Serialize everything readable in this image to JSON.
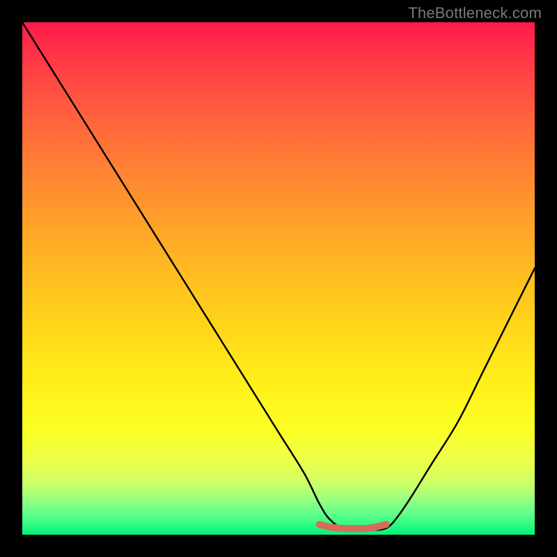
{
  "watermark_text": "TheBottleneck.com",
  "chart_data": {
    "type": "line",
    "title": "",
    "xlabel": "",
    "ylabel": "",
    "xlim": [
      0,
      100
    ],
    "ylim": [
      0,
      100
    ],
    "series": [
      {
        "name": "curve",
        "x": [
          0,
          5,
          10,
          15,
          20,
          25,
          30,
          35,
          40,
          45,
          50,
          55,
          58,
          60,
          63,
          67,
          70,
          72,
          75,
          80,
          85,
          90,
          95,
          100
        ],
        "y": [
          100,
          92,
          84,
          76,
          68,
          60,
          52,
          44,
          36,
          28,
          20,
          12,
          6,
          3,
          1,
          1,
          1,
          2,
          6,
          14,
          22,
          32,
          42,
          52
        ]
      },
      {
        "name": "valley-marker",
        "x": [
          58,
          60,
          63,
          65,
          67,
          69,
          71
        ],
        "y": [
          2,
          1.5,
          1.2,
          1.2,
          1.2,
          1.5,
          2
        ]
      }
    ],
    "colors": {
      "curve_stroke": "#000000",
      "valley_stroke": "#d86a5c",
      "gradient_top": "#ff1a4d",
      "gradient_bottom": "#00f578"
    }
  }
}
